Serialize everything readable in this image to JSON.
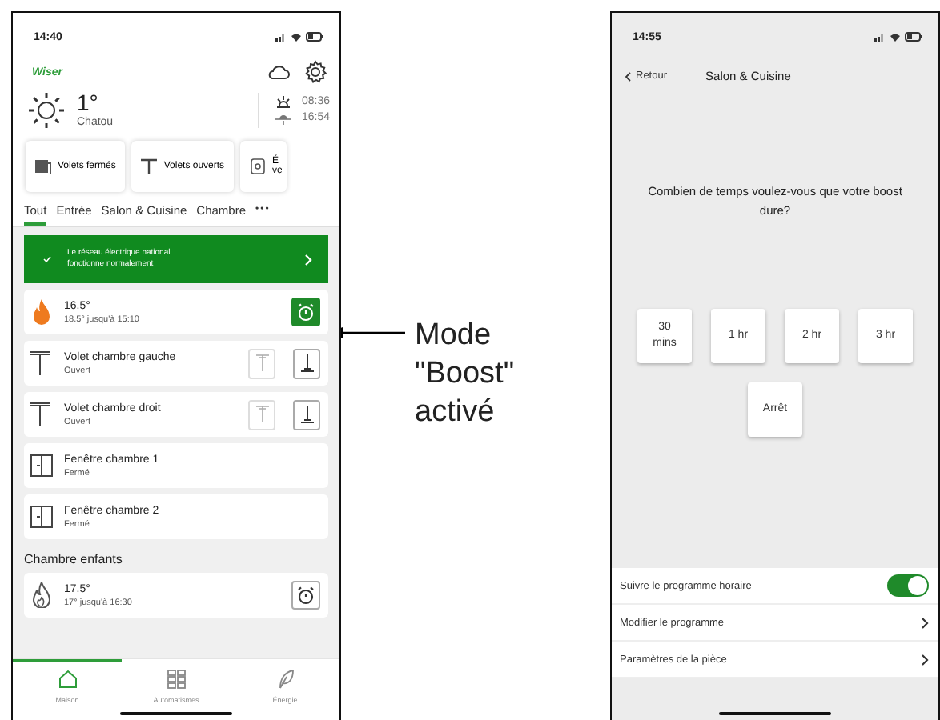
{
  "home_screen": {
    "status_time": "14:40",
    "logo": "Wiser",
    "weather": {
      "temperature": "1°",
      "city": "Chatou",
      "sunrise": "08:36",
      "sunset": "16:54"
    },
    "quick_actions": [
      {
        "kind": "closed",
        "label": "Volets fermés"
      },
      {
        "kind": "open",
        "label": "Volets ouverts"
      },
      {
        "kind": "other",
        "label": "É",
        "label_2": "ve"
      }
    ],
    "tabs": [
      {
        "label": "Tout",
        "selected": true
      },
      {
        "label": "Entrée",
        "selected": false
      },
      {
        "label": "Salon & Cuisine",
        "selected": false
      },
      {
        "label": "Chambre",
        "selected": false
      }
    ],
    "more": "•••",
    "banner": {
      "text": "Le réseau électrique national fonctionne normalement"
    },
    "sections": [
      {
        "devices": [
          {
            "kind": "heater",
            "title": "16.5°",
            "subtitle": "18.5° jusqu'à 15:10",
            "heating": true,
            "boost": true
          },
          {
            "kind": "shutter",
            "title": "Volet chambre gauche",
            "subtitle": "Ouvert"
          },
          {
            "kind": "shutter",
            "title": "Volet chambre droit",
            "subtitle": "Ouvert"
          },
          {
            "kind": "window",
            "title": "Fenêtre chambre 1",
            "subtitle": "Fermé"
          },
          {
            "kind": "window",
            "title": "Fenêtre chambre 2",
            "subtitle": "Fermé"
          }
        ]
      },
      {
        "heading": "Chambre enfants",
        "devices": [
          {
            "kind": "heater",
            "title": "17.5°",
            "subtitle": "17° jusqu'à 16:30",
            "heating": false,
            "boost": false
          }
        ]
      }
    ],
    "nav": [
      {
        "kind": "home",
        "label": "Maison",
        "selected": true
      },
      {
        "kind": "grid",
        "label": "Automatismes",
        "selected": false
      },
      {
        "kind": "leaf",
        "label": "Énergie",
        "selected": false
      }
    ]
  },
  "annotation": {
    "text": "Mode \"Boost\" activé"
  },
  "boost_screen": {
    "status_time": "14:55",
    "back": "Retour",
    "title": "Salon & Cuisine",
    "question": "Combien de temps voulez-vous que votre boost dure?",
    "durations": [
      {
        "label": "30 mins"
      },
      {
        "label": "1 hr"
      },
      {
        "label": "2 hr"
      },
      {
        "label": "3 hr"
      }
    ],
    "stop": "Arrêt",
    "settings": [
      {
        "kind": "toggle",
        "label": "Suivre le programme horaire",
        "on": true
      },
      {
        "kind": "link",
        "label": "Modifier le programme"
      },
      {
        "kind": "link",
        "label": "Paramètres de la pièce"
      }
    ]
  }
}
